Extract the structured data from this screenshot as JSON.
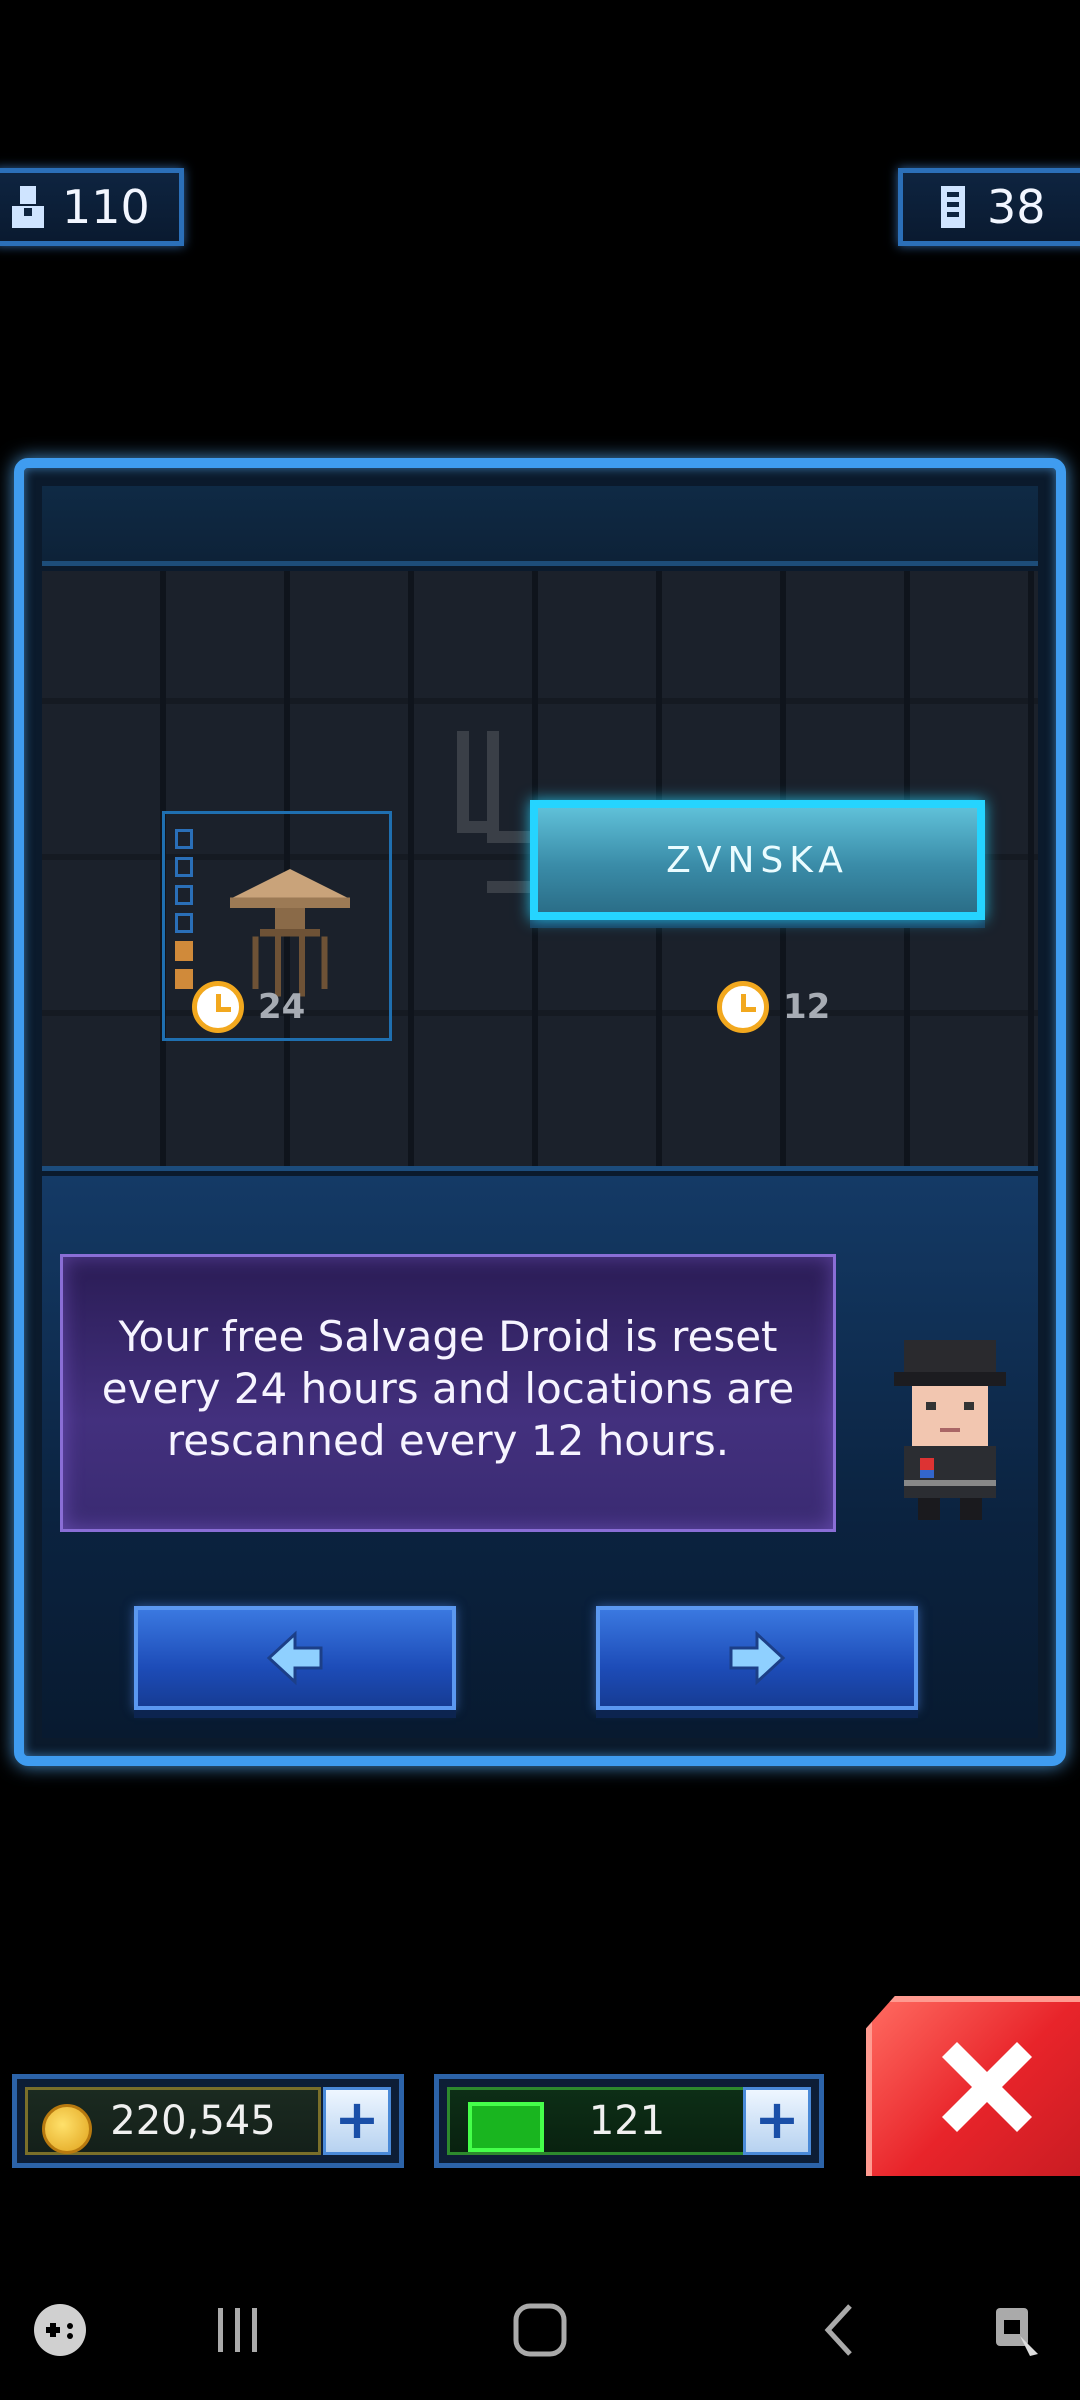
{
  "hud": {
    "population": "110",
    "floors": "38"
  },
  "panel": {
    "scan_button_label": "ZVNSKA",
    "droid_timer": "24",
    "scan_timer": "12",
    "message": "Your free Salvage Droid is reset every 24 hours and locations are rescanned every 12 hours."
  },
  "currency": {
    "coins": "220,545",
    "bux": "121"
  },
  "colors": {
    "panel_border": "#3f9cf0",
    "scan_button": "#25d4ff",
    "close_button": "#e8242a"
  }
}
